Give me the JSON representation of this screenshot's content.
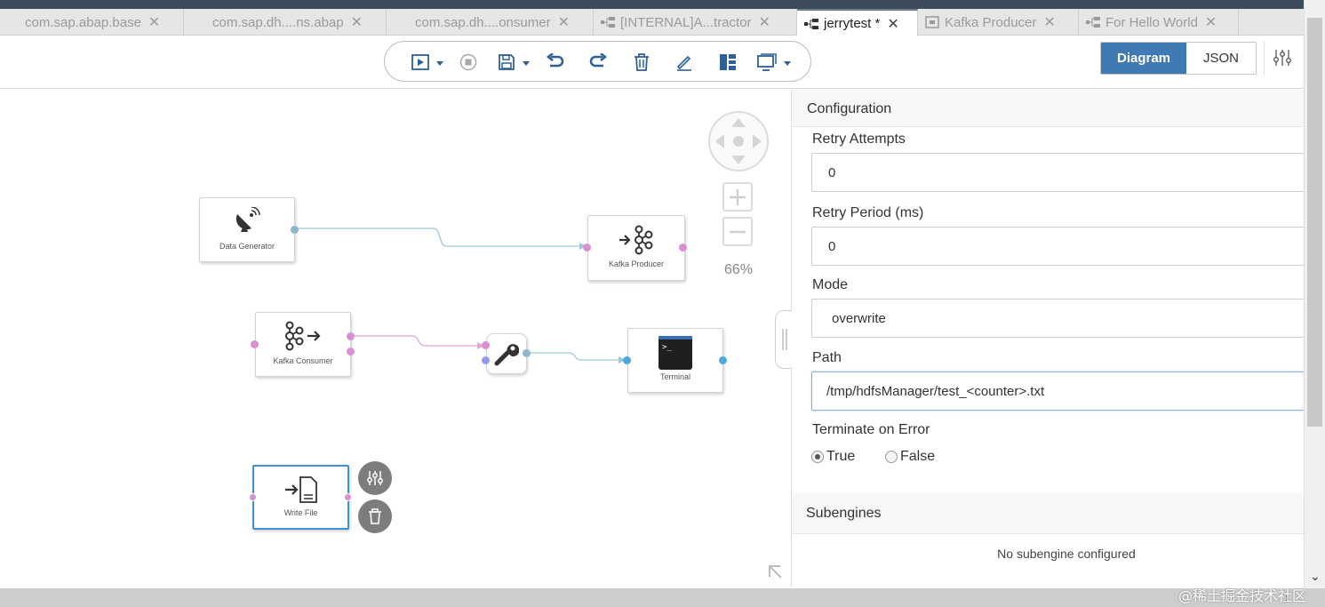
{
  "tabs": [
    {
      "label": "com.sap.abap.base",
      "icon": "none",
      "active": false
    },
    {
      "label": "com.sap.dh....ns.abap",
      "icon": "none",
      "active": false
    },
    {
      "label": "com.sap.dh....onsumer",
      "icon": "none",
      "active": false
    },
    {
      "label": "[INTERNAL]A...tractor",
      "icon": "graph-icon",
      "active": false
    },
    {
      "label": "jerrytest *",
      "icon": "graph-icon",
      "active": true
    },
    {
      "label": "Kafka Producer",
      "icon": "operator-icon",
      "active": false
    },
    {
      "label": "For Hello World",
      "icon": "graph-icon",
      "active": false
    }
  ],
  "toolbar": {
    "icons": [
      "run-icon",
      "stop-icon",
      "save-icon",
      "undo-icon",
      "redo-icon",
      "delete-icon",
      "edit-icon",
      "layout-icon",
      "screen-icon"
    ]
  },
  "view_switch": {
    "diagram": "Diagram",
    "json": "JSON",
    "active": "Diagram"
  },
  "canvas": {
    "zoom": "66%",
    "nodes": {
      "data_generator": "Data Generator",
      "kafka_producer": "Kafka Producer",
      "kafka_consumer": "Kafka Consumer",
      "terminal": "Terminal",
      "write_file": "Write File",
      "converter": ""
    }
  },
  "config": {
    "title": "Configuration",
    "retry_attempts_label": "Retry Attempts",
    "retry_attempts_value": "0",
    "retry_period_label": "Retry Period (ms)",
    "retry_period_value": "0",
    "mode_label": "Mode",
    "mode_value": "overwrite",
    "path_label": "Path",
    "path_value": "/tmp/hdfsManager/test_<counter>.txt",
    "terminate_label": "Terminate on Error",
    "terminate_options": [
      "True",
      "False"
    ],
    "terminate_selected": "True",
    "subengines_title": "Subengines",
    "subengines_empty": "No subengine configured"
  },
  "watermark": "@稀土掘金技术社区",
  "colors": {
    "accent": "#3f7ab5",
    "port_pink": "#d98fd1",
    "port_blue": "#4aa9de",
    "wire_blue": "#9fc6d8",
    "wire_pink": "#e2a6d6"
  }
}
